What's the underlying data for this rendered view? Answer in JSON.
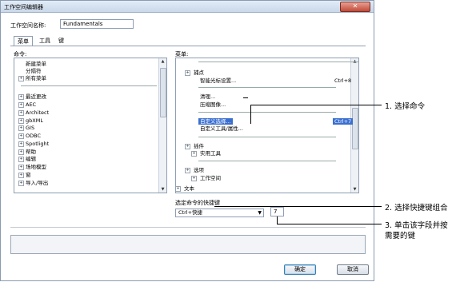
{
  "window": {
    "title": "工作空间编辑器",
    "close_glyph": "✕"
  },
  "workspace": {
    "name_label": "工作空间名称:",
    "name_value": "Fundamentals"
  },
  "tabs": [
    {
      "label": "菜单"
    },
    {
      "label": "工具"
    },
    {
      "label": "键"
    }
  ],
  "commands": {
    "label": "命令:",
    "items": [
      {
        "label": "新建菜单",
        "tw": ""
      },
      {
        "label": "分隔符",
        "tw": ""
      },
      {
        "label": "所有菜单",
        "tw": "+"
      },
      {
        "label": "最近更改",
        "tw": "+"
      },
      {
        "label": "AEC",
        "tw": "+"
      },
      {
        "label": "Architect",
        "tw": "+"
      },
      {
        "label": "gbXML",
        "tw": "+"
      },
      {
        "label": "GIS",
        "tw": "+"
      },
      {
        "label": "ODBC",
        "tw": "+"
      },
      {
        "label": "Spotlight",
        "tw": "+"
      },
      {
        "label": "帮助",
        "tw": "+"
      },
      {
        "label": "编辑",
        "tw": "+"
      },
      {
        "label": "场地模型",
        "tw": "+"
      },
      {
        "label": "窗",
        "tw": "+"
      },
      {
        "label": "导入/导出",
        "tw": "+"
      }
    ]
  },
  "menus": {
    "label": "菜单:",
    "items": [
      {
        "label": "捕点",
        "tw": "+",
        "shortcut": ""
      },
      {
        "label": "智能光标设置...",
        "tw": "",
        "shortcut": "Ctrl+8"
      },
      {
        "label": "清理...",
        "tw": "",
        "shortcut": ""
      },
      {
        "label": "压缩图像...",
        "tw": "",
        "shortcut": ""
      },
      {
        "label": "自定义选择...",
        "tw": "",
        "shortcut": "Ctrl+7"
      },
      {
        "label": "自定义工具/属性...",
        "tw": "",
        "shortcut": ""
      },
      {
        "label": "插件",
        "tw": "+",
        "shortcut": ""
      },
      {
        "label": "实用工具",
        "tw": "+",
        "shortcut": ""
      },
      {
        "label": "选项",
        "tw": "+",
        "shortcut": ""
      },
      {
        "label": "工作空间",
        "tw": "+",
        "shortcut": ""
      },
      {
        "label": "文本",
        "tw": "+",
        "shortcut": ""
      }
    ]
  },
  "shortcut": {
    "label": "选定命令的快捷键",
    "modifier": "Ctrl+快捷",
    "key": "7"
  },
  "buttons": {
    "ok": "确定",
    "cancel": "取消"
  },
  "callouts": [
    {
      "text": "1. 选择命令"
    },
    {
      "text": "2. 选择快捷键组合"
    },
    {
      "text": "3. 单击该字段并按"
    },
    {
      "text": "需要的键"
    }
  ]
}
